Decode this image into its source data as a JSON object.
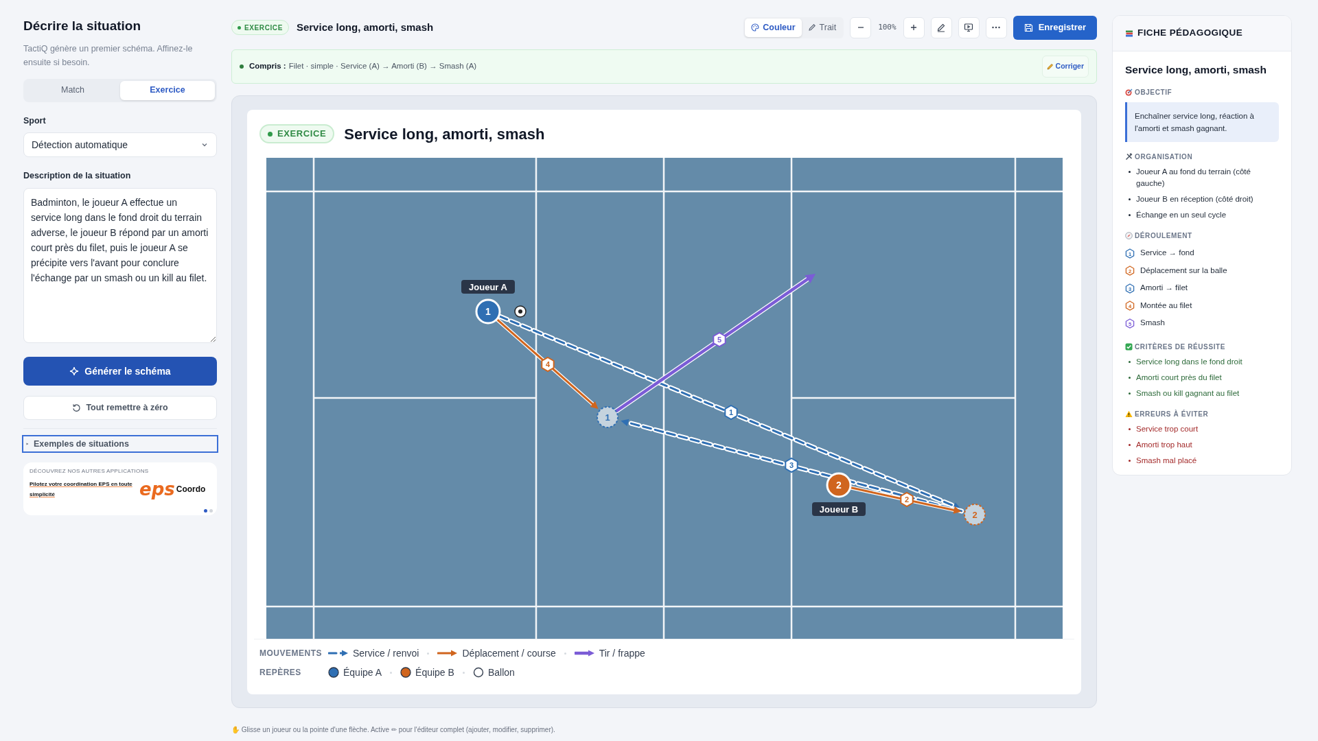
{
  "sidebar": {
    "title": "Décrire la situation",
    "subtitle": "TactiQ génère un premier schéma. Affinez-le ensuite si besoin.",
    "modes": [
      {
        "label": "Match",
        "selected": false
      },
      {
        "label": "Exercice",
        "selected": true
      }
    ],
    "sport_label": "Sport",
    "sport_value": "Détection automatique",
    "description_label": "Description de la situation",
    "description_value": "Badminton, le joueur A effectue un service long dans le fond droit du terrain adverse, le joueur B répond par un amorti court près du filet, puis le joueur A se précipite vers l'avant pour conclure l'échange par un smash ou un kill au filet.",
    "generate_button": "Générer le schéma",
    "reset_button": "Tout remettre à zéro",
    "examples": {
      "label": "Exemples de situations",
      "expanded": false
    },
    "promo": {
      "eyebrow": "DÉCOUVREZ NOS AUTRES APPLICATIONS",
      "text": "Pilotez votre coordination EPS en toute simplicité",
      "logo_mark": "eps",
      "logo_text": "Coordo",
      "dots": [
        {
          "selected": true
        },
        {
          "selected": false
        }
      ]
    }
  },
  "header": {
    "badge": "EXERCICE",
    "title": "Service long, amorti, smash",
    "style_tabs": [
      {
        "label": "Couleur",
        "selected": true
      },
      {
        "label": "Trait",
        "selected": false
      }
    ],
    "zoom": "100%",
    "save_button": "Enregistrer"
  },
  "understood": {
    "label": "Compris :",
    "text": "Filet · simple · Service (A) → Amorti (B) → Smash (A)",
    "fix_button": "Corriger"
  },
  "diagram": {
    "badge": "EXERCICE",
    "title": "Service long, amorti, smash",
    "players": [
      {
        "kind": "team_a",
        "number": "1",
        "label": "Joueur A"
      },
      {
        "kind": "team_b",
        "number": "2",
        "label": "Joueur B"
      }
    ],
    "ghosts": [
      {
        "kind": "team_a",
        "number": "1"
      },
      {
        "kind": "team_b",
        "number": "2"
      }
    ],
    "arrows": [
      {
        "kind": "pass",
        "step": "1"
      },
      {
        "kind": "run",
        "step": "2"
      },
      {
        "kind": "pass",
        "step": "3"
      },
      {
        "kind": "run",
        "step": "4"
      },
      {
        "kind": "shot",
        "step": "5"
      }
    ],
    "legend": [
      {
        "title": "MOUVEMENTS",
        "items": [
          {
            "kind": "pass",
            "label": "Service / renvoi"
          },
          {
            "kind": "run",
            "label": "Déplacement / course"
          },
          {
            "kind": "shot",
            "label": "Tir / frappe"
          }
        ]
      },
      {
        "title": "REPÈRES",
        "items": [
          {
            "kind": "team_a",
            "label": "Équipe A"
          },
          {
            "kind": "team_b",
            "label": "Équipe B"
          },
          {
            "kind": "ball",
            "label": "Ballon"
          }
        ]
      }
    ]
  },
  "hint": "✋ Glisse un joueur ou la pointe d'une flèche. Active ✏ pour l'éditeur complet (ajouter, modifier, supprimer).",
  "sheet": {
    "heading": "FICHE PÉDAGOGIQUE",
    "title": "Service long, amorti, smash",
    "sections": [
      {
        "kind": "objective",
        "title": "OBJECTIF",
        "text": "Enchaîner service long, réaction à l'amorti et smash gagnant."
      },
      {
        "kind": "organisation",
        "title": "ORGANISATION",
        "items": [
          "Joueur A au fond du terrain (côté gauche)",
          "Joueur B en réception (côté droit)",
          "Échange en un seul cycle"
        ]
      },
      {
        "kind": "steps",
        "title": "DÉROULEMENT",
        "steps": [
          {
            "kind": "pass",
            "number": "1",
            "text": "Service → fond"
          },
          {
            "kind": "run",
            "number": "2",
            "text": "Déplacement sur la balle"
          },
          {
            "kind": "pass",
            "number": "3",
            "text": "Amorti → filet"
          },
          {
            "kind": "run",
            "number": "4",
            "text": "Montée au filet"
          },
          {
            "kind": "shot",
            "number": "5",
            "text": "Smash"
          }
        ]
      },
      {
        "kind": "success",
        "title": "CRITÈRES DE RÉUSSITE",
        "items": [
          "Service long dans le fond droit",
          "Amorti court près du filet",
          "Smash ou kill gagnant au filet"
        ]
      },
      {
        "kind": "errors",
        "title": "ERREURS À ÉVITER",
        "items": [
          "Service trop court",
          "Amorti trop haut",
          "Smash mal placé"
        ]
      }
    ]
  }
}
